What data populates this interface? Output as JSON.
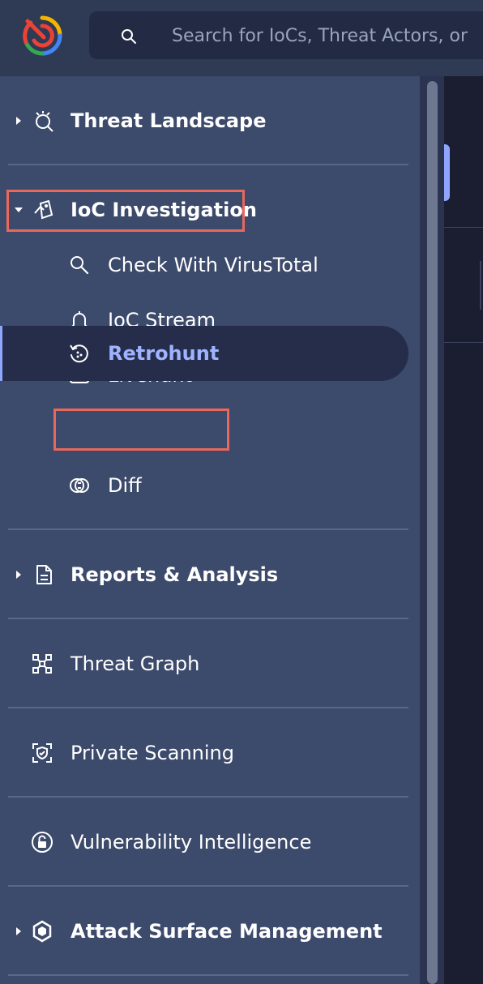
{
  "search": {
    "placeholder": "Search for IoCs, Threat Actors, or"
  },
  "nav": {
    "threat_landscape": "Threat Landscape",
    "ioc_investigation": "IoC Investigation",
    "ioc_children": {
      "check_virustotal": "Check With VirusTotal",
      "ioc_stream": "IoC Stream",
      "livehunt": "Livehunt",
      "retrohunt": "Retrohunt",
      "diff": "Diff"
    },
    "reports_analysis": "Reports & Analysis",
    "threat_graph": "Threat Graph",
    "private_scanning": "Private Scanning",
    "vulnerability_intelligence": "Vulnerability Intelligence",
    "attack_surface_management": "Attack Surface Management"
  },
  "colors": {
    "sidebar_bg": "#3c4a6b",
    "active_text": "#9fb3ff",
    "highlight_box": "#e8685c"
  }
}
